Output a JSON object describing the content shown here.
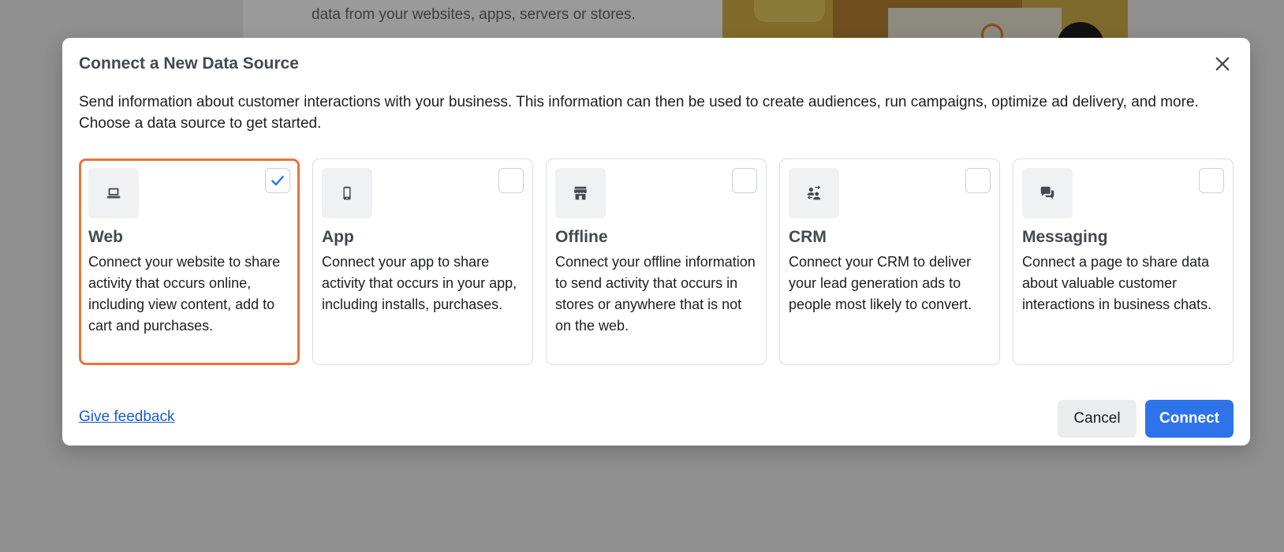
{
  "background": {
    "text": "data from your websites, apps, servers or stores."
  },
  "modal": {
    "title": "Connect a New Data Source",
    "description": "Send information about customer interactions with your business. This information can then be used to create audiences, run campaigns, optimize ad delivery, and more. Choose a data source to get started.",
    "close_icon": "close-icon"
  },
  "options": [
    {
      "title": "Web",
      "description": "Connect your website to share activity that occurs online, including view content, add to cart and purchases.",
      "icon": "laptop-icon",
      "selected": true
    },
    {
      "title": "App",
      "description": "Connect your app to share activity that occurs in your app, including installs, purchases.",
      "icon": "phone-icon",
      "selected": false
    },
    {
      "title": "Offline",
      "description": "Connect your offline information to send activity that occurs in stores or anywhere that is not on the web.",
      "icon": "store-icon",
      "selected": false
    },
    {
      "title": "CRM",
      "description": "Connect your CRM to deliver your lead generation ads to people most likely to convert.",
      "icon": "people-icon",
      "selected": false
    },
    {
      "title": "Messaging",
      "description": "Connect a page to share data about valuable customer interactions in business chats.",
      "icon": "chat-icon",
      "selected": false
    }
  ],
  "footer": {
    "feedback_label": "Give feedback",
    "cancel_label": "Cancel",
    "connect_label": "Connect"
  },
  "colors": {
    "selected_border": "#e8743b",
    "primary_button": "#2f73ea",
    "link": "#1a5bd1",
    "check": "#1877f2"
  }
}
